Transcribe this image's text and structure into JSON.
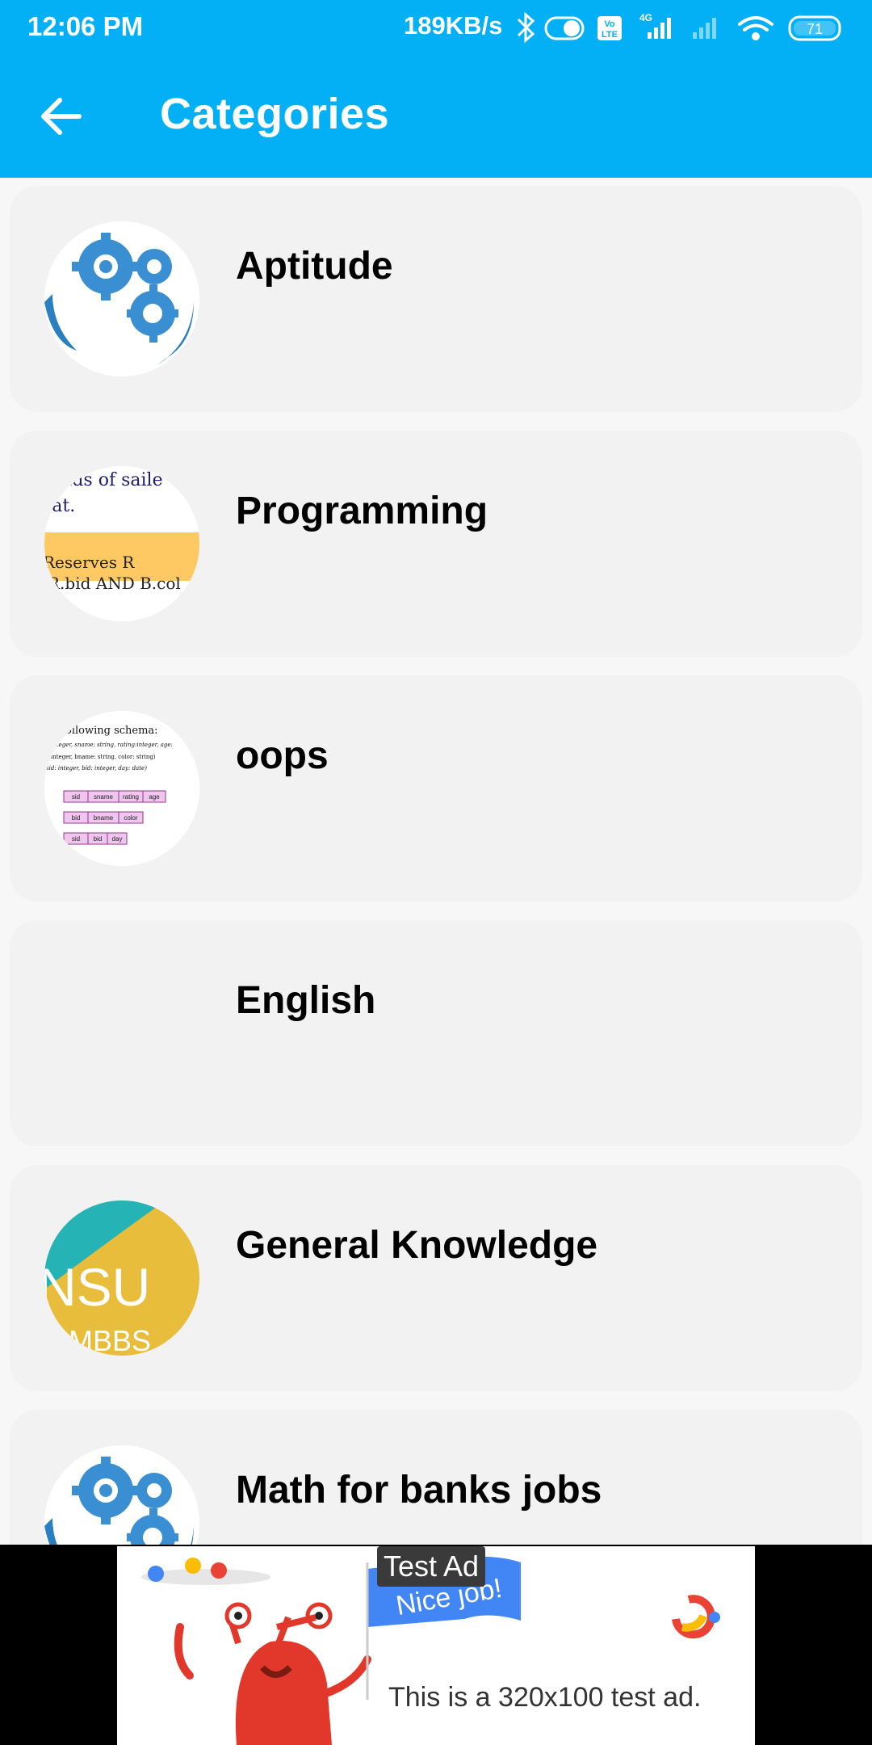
{
  "status_bar": {
    "time": "12:06 PM",
    "network_speed": "189KB/s",
    "network_type": "4G",
    "battery": "71",
    "icons": [
      "bluetooth-icon",
      "toggle-icon",
      "volte-icon",
      "signal-icon",
      "signal-weak-icon",
      "wifi-icon",
      "battery-icon"
    ]
  },
  "app_bar": {
    "title": "Categories",
    "back_icon": "arrow-left-icon"
  },
  "categories": [
    {
      "label": "Aptitude",
      "thumbnail": "gears-icon"
    },
    {
      "label": "Programming",
      "thumbnail": "sql-snippet-image",
      "thumb_text": [
        "e sids of saile",
        "oat.",
        "Reserves R",
        "R.bid AND B.col"
      ]
    },
    {
      "label": "oops",
      "thumbnail": "schema-image",
      "thumb_text": [
        "ollowing schema:",
        "integer, sname: string, rating:integer, age:",
        "integer, bname: string, color: string)",
        "sid: integer, bid: integer, day: date)",
        "sid",
        "sname",
        "rating",
        "age",
        "bid",
        "bname",
        "color",
        "sid",
        "bid",
        "day"
      ]
    },
    {
      "label": "English",
      "thumbnail": ""
    },
    {
      "label": "General Knowledge",
      "thumbnail": "consult-logo-image",
      "thumb_text": [
        "NSU",
        ". MBBS"
      ]
    },
    {
      "label": "Math for banks jobs",
      "thumbnail": "gears-icon"
    }
  ],
  "ad": {
    "badge": "Test Ad",
    "banner_text": "Nice job!",
    "description": "This is a 320x100 test ad."
  },
  "colors": {
    "primary": "#03b0f5",
    "card_background": "#f2f2f2",
    "page_background": "#f7f7f7"
  }
}
